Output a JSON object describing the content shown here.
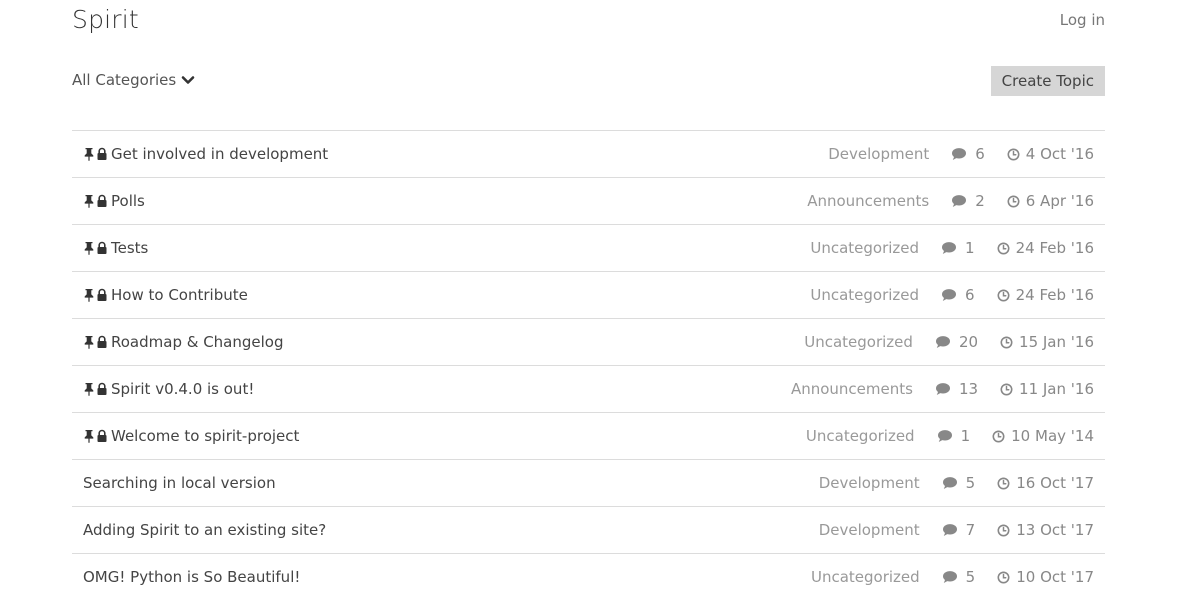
{
  "header": {
    "brand": "Spirit",
    "login_label": "Log in"
  },
  "toolbar": {
    "category_filter": "All Categories",
    "create_topic_label": "Create Topic"
  },
  "topics": [
    {
      "title": "Get involved in development",
      "pinned": true,
      "locked": true,
      "category": "Development",
      "comments": "6",
      "date": "4 Oct '16"
    },
    {
      "title": "Polls",
      "pinned": true,
      "locked": true,
      "category": "Announcements",
      "comments": "2",
      "date": "6 Apr '16"
    },
    {
      "title": "Tests",
      "pinned": true,
      "locked": true,
      "category": "Uncategorized",
      "comments": "1",
      "date": "24 Feb '16"
    },
    {
      "title": "How to Contribute",
      "pinned": true,
      "locked": true,
      "category": "Uncategorized",
      "comments": "6",
      "date": "24 Feb '16"
    },
    {
      "title": "Roadmap & Changelog",
      "pinned": true,
      "locked": true,
      "category": "Uncategorized",
      "comments": "20",
      "date": "15 Jan '16"
    },
    {
      "title": "Spirit v0.4.0 is out!",
      "pinned": true,
      "locked": true,
      "category": "Announcements",
      "comments": "13",
      "date": "11 Jan '16"
    },
    {
      "title": "Welcome to spirit-project",
      "pinned": true,
      "locked": true,
      "category": "Uncategorized",
      "comments": "1",
      "date": "10 May '14"
    },
    {
      "title": "Searching in local version",
      "pinned": false,
      "locked": false,
      "category": "Development",
      "comments": "5",
      "date": "16 Oct '17"
    },
    {
      "title": "Adding Spirit to an existing site?",
      "pinned": false,
      "locked": false,
      "category": "Development",
      "comments": "7",
      "date": "13 Oct '17"
    },
    {
      "title": "OMG! Python is So Beautiful!",
      "pinned": false,
      "locked": false,
      "category": "Uncategorized",
      "comments": "5",
      "date": "10 Oct '17"
    }
  ],
  "icons": {
    "pin": "pin-icon",
    "lock": "lock-icon",
    "comment": "comment-icon",
    "clock": "clock-icon",
    "chevron": "chevron-down-icon"
  },
  "colors": {
    "text": "#444444",
    "muted": "#999999",
    "button_bg": "#d6d6d6",
    "divider": "#dcdcdc"
  }
}
